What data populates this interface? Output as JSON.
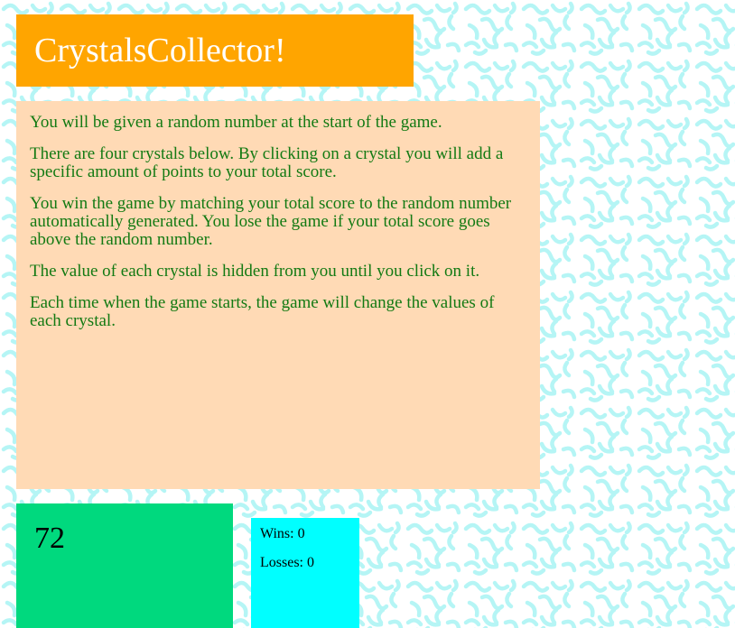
{
  "game": {
    "title": "CrystalsCollector!",
    "instructions": [
      "You will be given a random number at the start of the game.",
      "There are four crystals below. By clicking on a crystal you will add a specific amount of points to your total score.",
      "You win the game by matching your total score to the random number automatically generated. You lose the game if your total score goes above the random number.",
      "The value of each crystal is hidden from you until you click on it.",
      "Each time when the game starts, the game will change the values of each crystal."
    ],
    "target_number": "72",
    "score": {
      "wins_label": "Wins: 0",
      "losses_label": "Losses: 0"
    }
  },
  "colors": {
    "title_bg": "#ffa500",
    "instructions_bg": "#ffdab5",
    "instructions_text": "#137a13",
    "target_bg": "#00d97e",
    "score_bg": "#00ffff",
    "pattern": "#b5f5f5"
  }
}
